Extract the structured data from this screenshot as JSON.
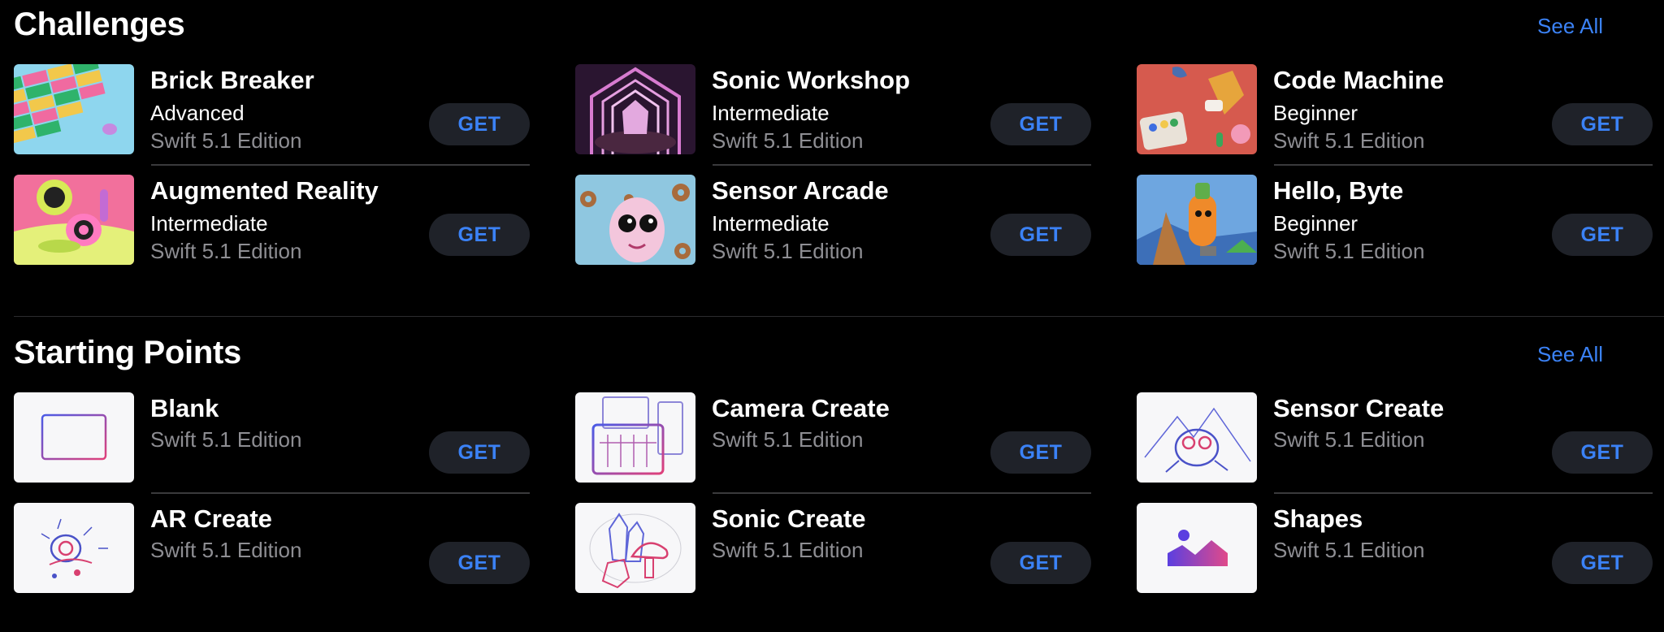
{
  "challenges": {
    "title": "Challenges",
    "see_all": "See All",
    "items": [
      {
        "name": "Brick Breaker",
        "level": "Advanced",
        "edition": "Swift 5.1 Edition",
        "get": "GET"
      },
      {
        "name": "Sonic Workshop",
        "level": "Intermediate",
        "edition": "Swift 5.1 Edition",
        "get": "GET"
      },
      {
        "name": "Code Machine",
        "level": "Beginner",
        "edition": "Swift 5.1 Edition",
        "get": "GET"
      },
      {
        "name": "Augmented Reality",
        "level": "Intermediate",
        "edition": "Swift 5.1 Edition",
        "get": "GET"
      },
      {
        "name": "Sensor Arcade",
        "level": "Intermediate",
        "edition": "Swift 5.1 Edition",
        "get": "GET"
      },
      {
        "name": "Hello, Byte",
        "level": "Beginner",
        "edition": "Swift 5.1 Edition",
        "get": "GET"
      }
    ]
  },
  "starting_points": {
    "title": "Starting Points",
    "see_all": "See All",
    "items": [
      {
        "name": "Blank",
        "edition": "Swift 5.1 Edition",
        "get": "GET"
      },
      {
        "name": "Camera Create",
        "edition": "Swift 5.1 Edition",
        "get": "GET"
      },
      {
        "name": "Sensor Create",
        "edition": "Swift 5.1 Edition",
        "get": "GET"
      },
      {
        "name": "AR Create",
        "edition": "Swift 5.1 Edition",
        "get": "GET"
      },
      {
        "name": "Sonic Create",
        "edition": "Swift 5.1 Edition",
        "get": "GET"
      },
      {
        "name": "Shapes",
        "edition": "Swift 5.1 Edition",
        "get": "GET"
      }
    ]
  },
  "colors": {
    "background": "#000000",
    "accent": "#3b82f6",
    "button_bg": "#1f2229",
    "secondary_text": "#8e8e93"
  }
}
